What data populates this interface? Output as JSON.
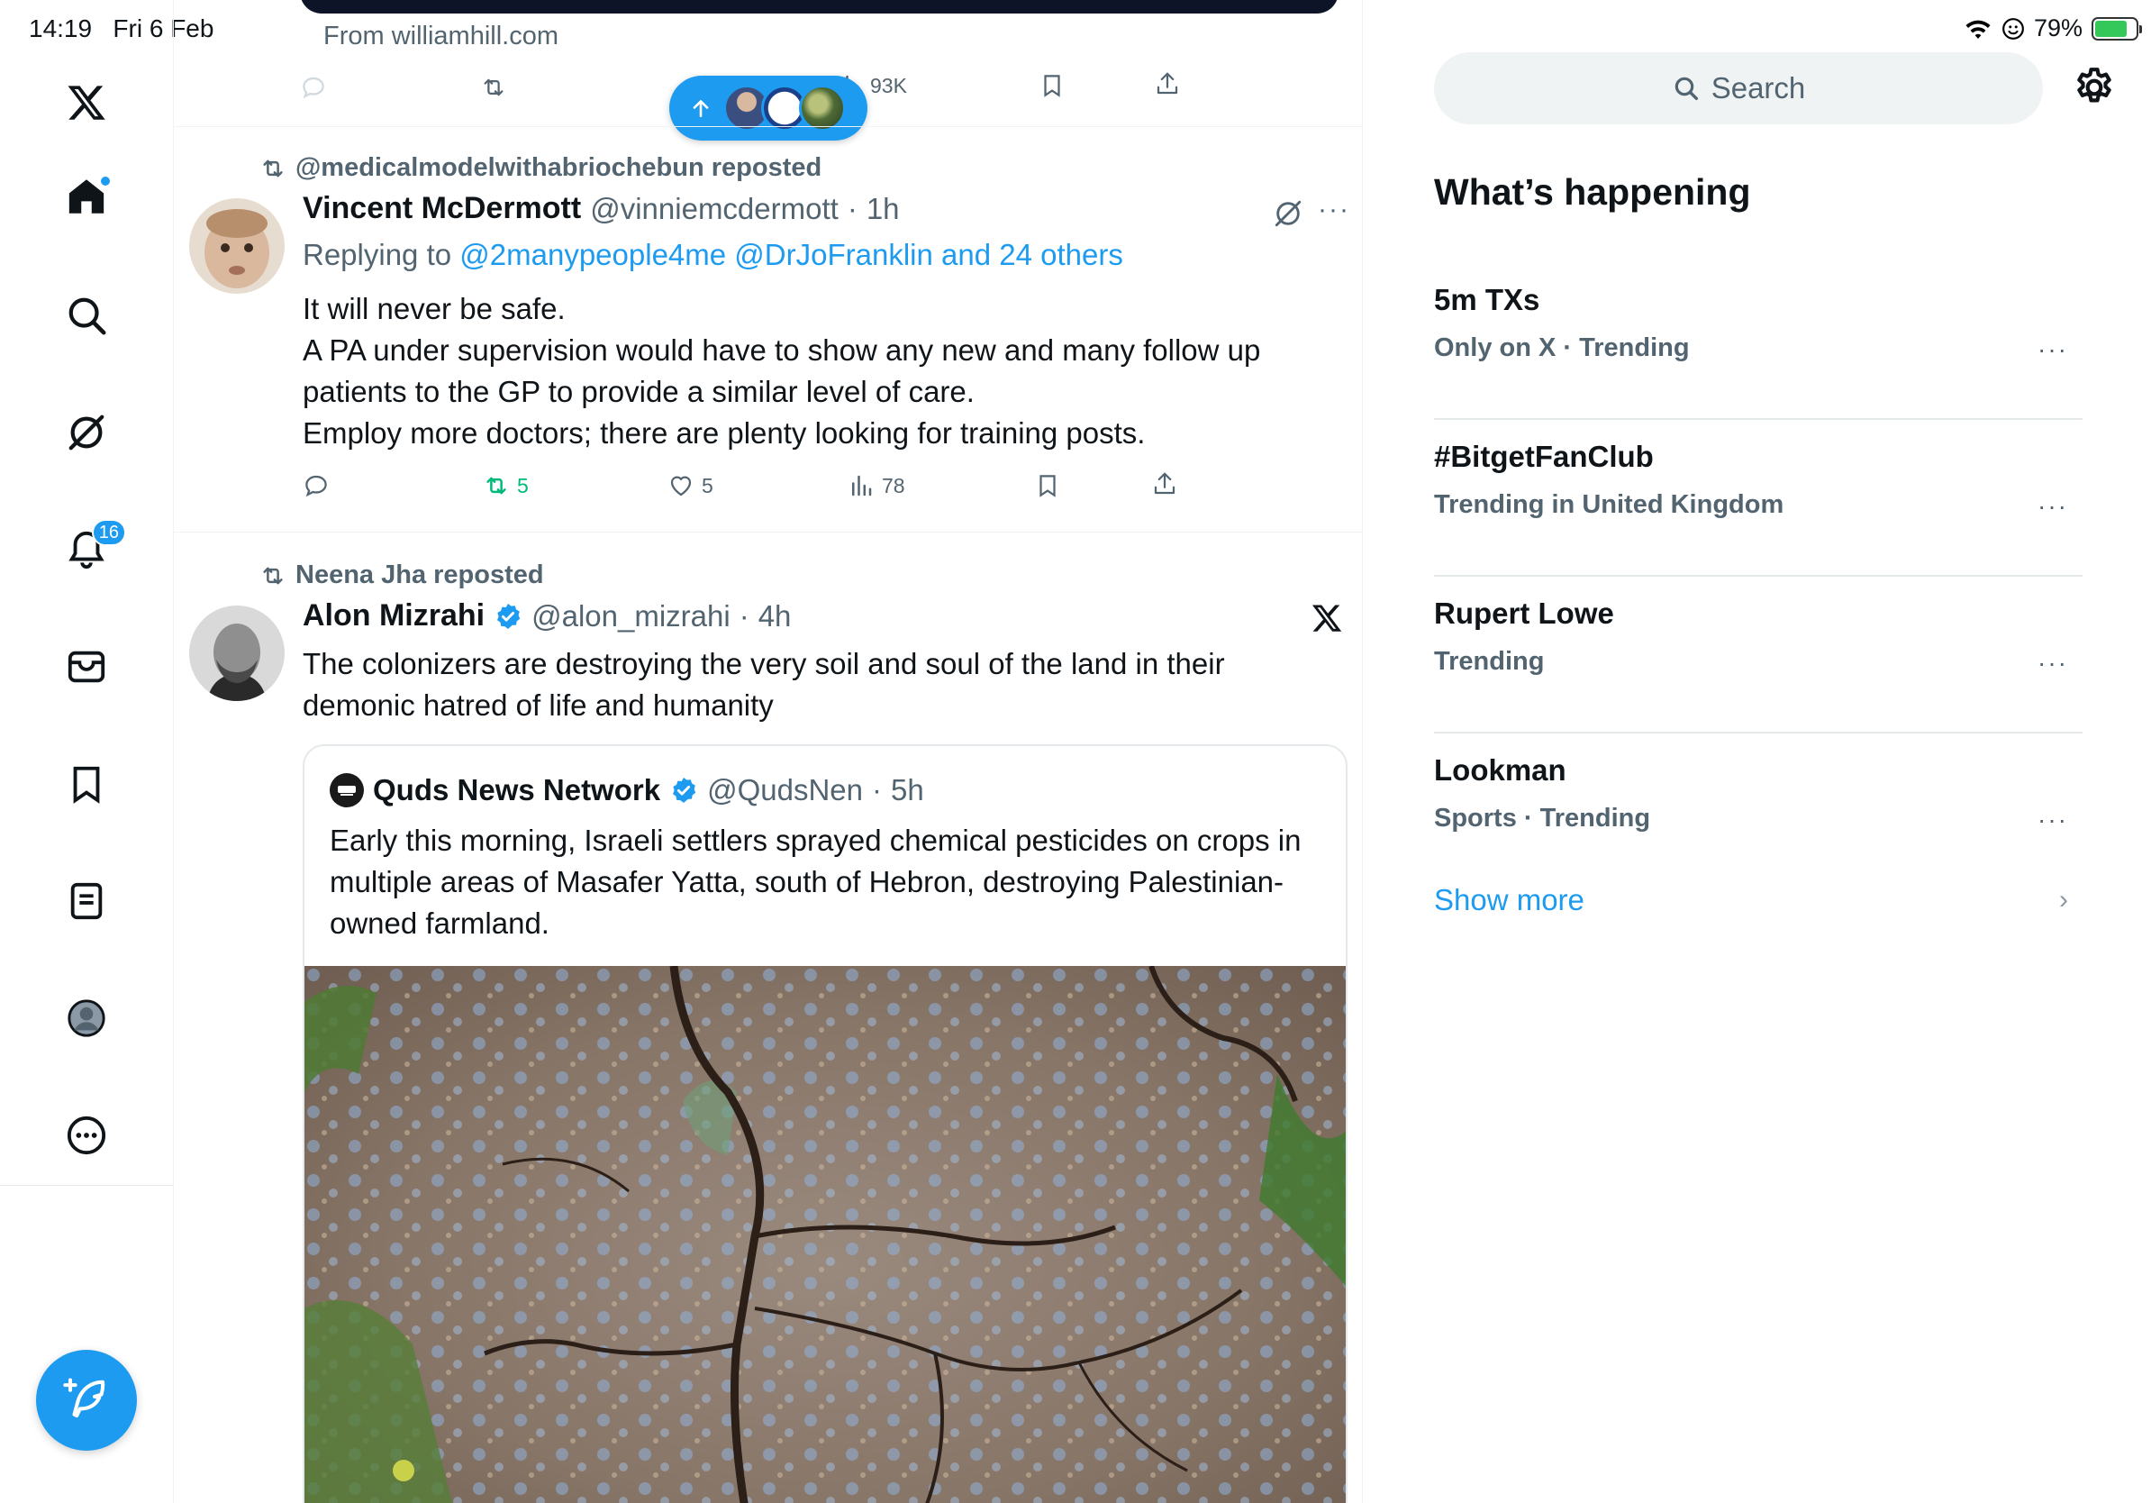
{
  "status_bar": {
    "time": "14:19",
    "date": "Fri 6 Feb",
    "battery": "79%",
    "battery_level": 0.79
  },
  "nav": {
    "notifications_badge": "16",
    "items": [
      "home-icon",
      "explore-icon",
      "grok-icon",
      "notifications-icon",
      "messages-icon",
      "bookmarks-icon",
      "lists-icon",
      "profile-icon",
      "more-icon"
    ]
  },
  "ad": {
    "from_text": "From williamhill.com",
    "views": "93K"
  },
  "posts": [
    {
      "reposted_by": "@medicalmodelwithabriochebun reposted",
      "name": "Vincent McDermott",
      "handle": "@vinniemcdermott",
      "time": "1h",
      "replying_prefix": "Replying to",
      "replying_to": "@2manypeople4me @DrJoFranklin and 24 others",
      "text": "It will never be safe.\nA PA under supervision would have to show any new and many follow up patients to the GP to provide a similar level of care.\nEmploy more doctors; there are plenty looking for training posts.",
      "reposts": "5",
      "likes": "5",
      "views": "78"
    },
    {
      "reposted_by": "Neena Jha reposted",
      "name": "Alon Mizrahi",
      "handle": "@alon_mizrahi",
      "time": "4h",
      "text": "The colonizers are destroying the very soil and soul of the land in their demonic hatred of life and humanity",
      "quote": {
        "name": "Quds News Network",
        "handle": "@QudsNen",
        "time": "5h",
        "text": "Early this morning, Israeli settlers sprayed chemical pesticides on crops in multiple areas of Masafer Yatta, south of Hebron, destroying Palestinian-owned farmland."
      }
    }
  ],
  "sidebar": {
    "search_placeholder": "Search",
    "trends_title": "What’s happening",
    "trends": [
      {
        "name": "5m TXs",
        "meta": "Only on X · Trending"
      },
      {
        "name": "#BitgetFanClub",
        "meta": "Trending in United Kingdom"
      },
      {
        "name": "Rupert Lowe",
        "meta": "Trending"
      },
      {
        "name": "Lookman",
        "meta": "Sports · Trending"
      }
    ],
    "show_more": "Show more"
  },
  "colors": {
    "accent": "#1d9bf0",
    "repost_green": "#00ba7c",
    "secondary_text": "#536471"
  }
}
